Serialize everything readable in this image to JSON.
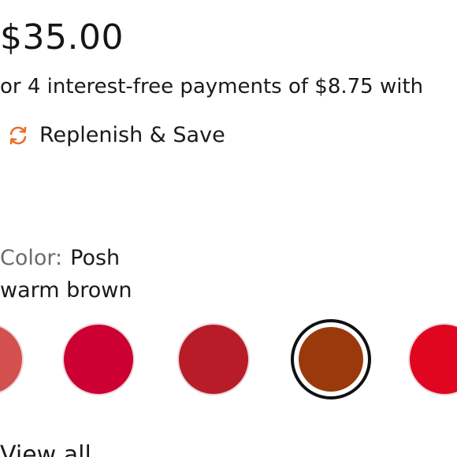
{
  "product": {
    "price": "$35.00",
    "installments_text": "or 4 interest-free payments of $8.75 with"
  },
  "replenish": {
    "label": "Replenish & Save",
    "icon": "refresh-cycle-icon",
    "icon_color": "#e8702a"
  },
  "color": {
    "label_prefix": "Color:",
    "selected_name": "Posh",
    "selected_description": "warm brown"
  },
  "swatches": [
    {
      "color": "#d4504f",
      "selected": false
    },
    {
      "color": "#cc0033",
      "selected": false
    },
    {
      "color": "#b81c28",
      "selected": false
    },
    {
      "color": "#9a3a0c",
      "selected": true
    },
    {
      "color": "#e0061f",
      "selected": false
    }
  ],
  "view_all": {
    "label": "View all"
  }
}
